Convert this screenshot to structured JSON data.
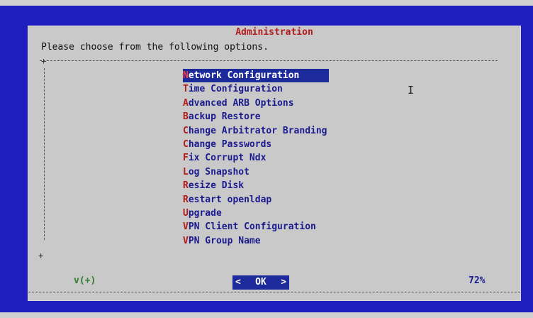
{
  "dialog": {
    "title": "Administration",
    "subtitle": "Please choose from the following options."
  },
  "menu": {
    "items": [
      {
        "hot": "N",
        "rest": "etwork Configuration",
        "selected": true
      },
      {
        "hot": "T",
        "rest": "ime Configuration"
      },
      {
        "hot": "A",
        "rest": "dvanced ARB Options"
      },
      {
        "hot": "B",
        "rest": "ackup Restore"
      },
      {
        "hot": "C",
        "rest": "hange Arbitrator Branding"
      },
      {
        "hot": "C",
        "rest": "hange Passwords"
      },
      {
        "hot": "F",
        "rest": "ix Corrupt Ndx"
      },
      {
        "hot": "L",
        "rest": "og Snapshot"
      },
      {
        "hot": "R",
        "rest": "esize Disk"
      },
      {
        "hot": "R",
        "rest": "estart openldap"
      },
      {
        "hot": "U",
        "rest": "pgrade"
      },
      {
        "hot": "V",
        "rest": "PN Client Configuration"
      },
      {
        "hot": "V",
        "rest": "PN Group Name"
      }
    ],
    "more_indicator": "v(+)",
    "scroll_percent": "72%"
  },
  "buttons": {
    "ok": {
      "left": "<",
      "hot": " ",
      "label": "OK",
      "right": ">"
    }
  },
  "colors": {
    "background": "#1f1fc0",
    "dialog": "#c9c9c9",
    "title": "#b31b1b",
    "selection": "#1d2a9c",
    "item_text": "#1b1b8f",
    "hotkey": "#b31b1b"
  },
  "icons": {
    "mouse_cursor": "text-ibeam-icon"
  }
}
